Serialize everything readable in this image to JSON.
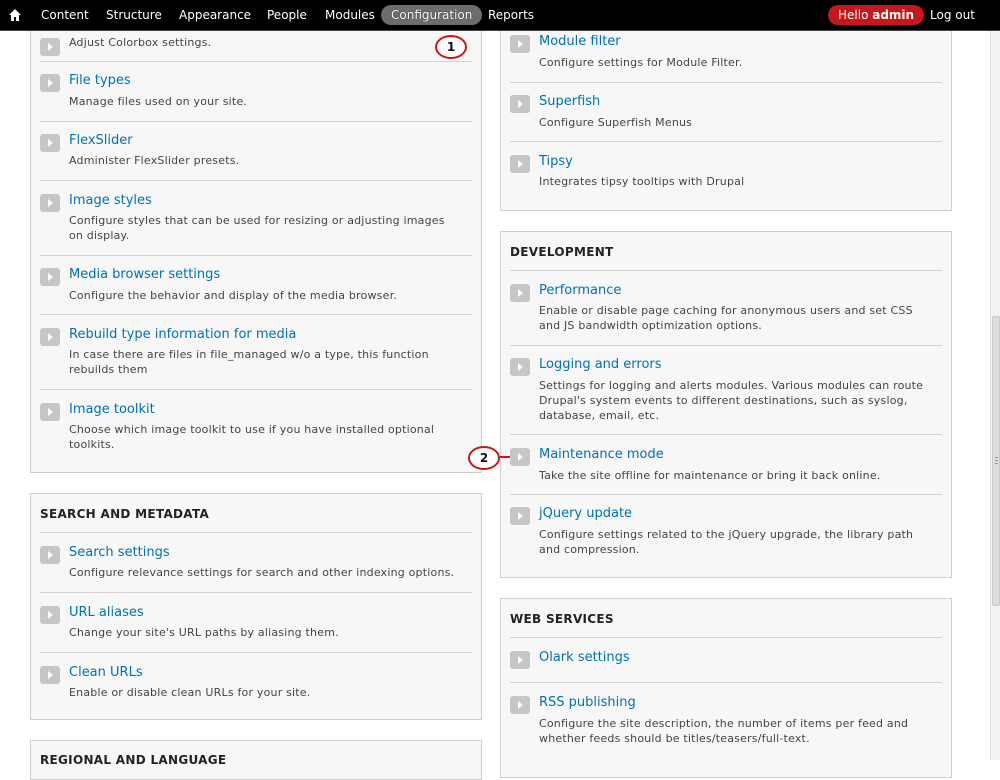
{
  "toolbar": {
    "home_icon": "home-icon",
    "items": [
      "Content",
      "Structure",
      "Appearance",
      "People",
      "Modules",
      "Configuration",
      "Reports"
    ],
    "hello_text": "Hello ",
    "user_name": "admin",
    "logout": "Log out"
  },
  "callouts": [
    "1",
    "2"
  ],
  "left_top_panel": {
    "partial_desc": "Adjust Colorbox settings.",
    "items": [
      {
        "label": "File types",
        "desc": "Manage files used on your site."
      },
      {
        "label": "FlexSlider",
        "desc": "Administer FlexSlider presets."
      },
      {
        "label": "Image styles",
        "desc": "Configure styles that can be used for resizing or adjusting images on display."
      },
      {
        "label": "Media browser settings",
        "desc": "Configure the behavior and display of the media browser."
      },
      {
        "label": "Rebuild type information for media",
        "desc": "In case there are files in file_managed w/o a type, this function rebuilds them"
      },
      {
        "label": "Image toolkit",
        "desc": "Choose which image toolkit to use if you have installed optional toolkits."
      }
    ]
  },
  "search_panel": {
    "title": "SEARCH AND METADATA",
    "items": [
      {
        "label": "Search settings",
        "desc": "Configure relevance settings for search and other indexing options."
      },
      {
        "label": "URL aliases",
        "desc": "Change your site's URL paths by aliasing them."
      },
      {
        "label": "Clean URLs",
        "desc": "Enable or disable clean URLs for your site."
      }
    ]
  },
  "regional_panel": {
    "title": "REGIONAL AND LANGUAGE"
  },
  "right_top_panel": {
    "items": [
      {
        "label": "Module filter",
        "desc": "Configure settings for Module Filter."
      },
      {
        "label": "Superfish",
        "desc": "Configure Superfish Menus"
      },
      {
        "label": "Tipsy",
        "desc": "Integrates tipsy tooltips with Drupal"
      }
    ]
  },
  "development_panel": {
    "title": "DEVELOPMENT",
    "items": [
      {
        "label": "Performance",
        "desc": "Enable or disable page caching for anonymous users and set CSS and JS bandwidth optimization options."
      },
      {
        "label": "Logging and errors",
        "desc": "Settings for logging and alerts modules. Various modules can route Drupal's system events to different destinations, such as syslog, database, email, etc."
      },
      {
        "label": "Maintenance mode",
        "desc": "Take the site offline for maintenance or bring it back online."
      },
      {
        "label": "jQuery update",
        "desc": "Configure settings related to the jQuery upgrade, the library path and compression."
      }
    ]
  },
  "webservices_panel": {
    "title": "WEB SERVICES",
    "items": [
      {
        "label": "Olark settings",
        "desc": ""
      },
      {
        "label": "RSS publishing",
        "desc": "Configure the site description, the number of items per feed and whether feeds should be titles/teasers/full-text."
      }
    ]
  }
}
